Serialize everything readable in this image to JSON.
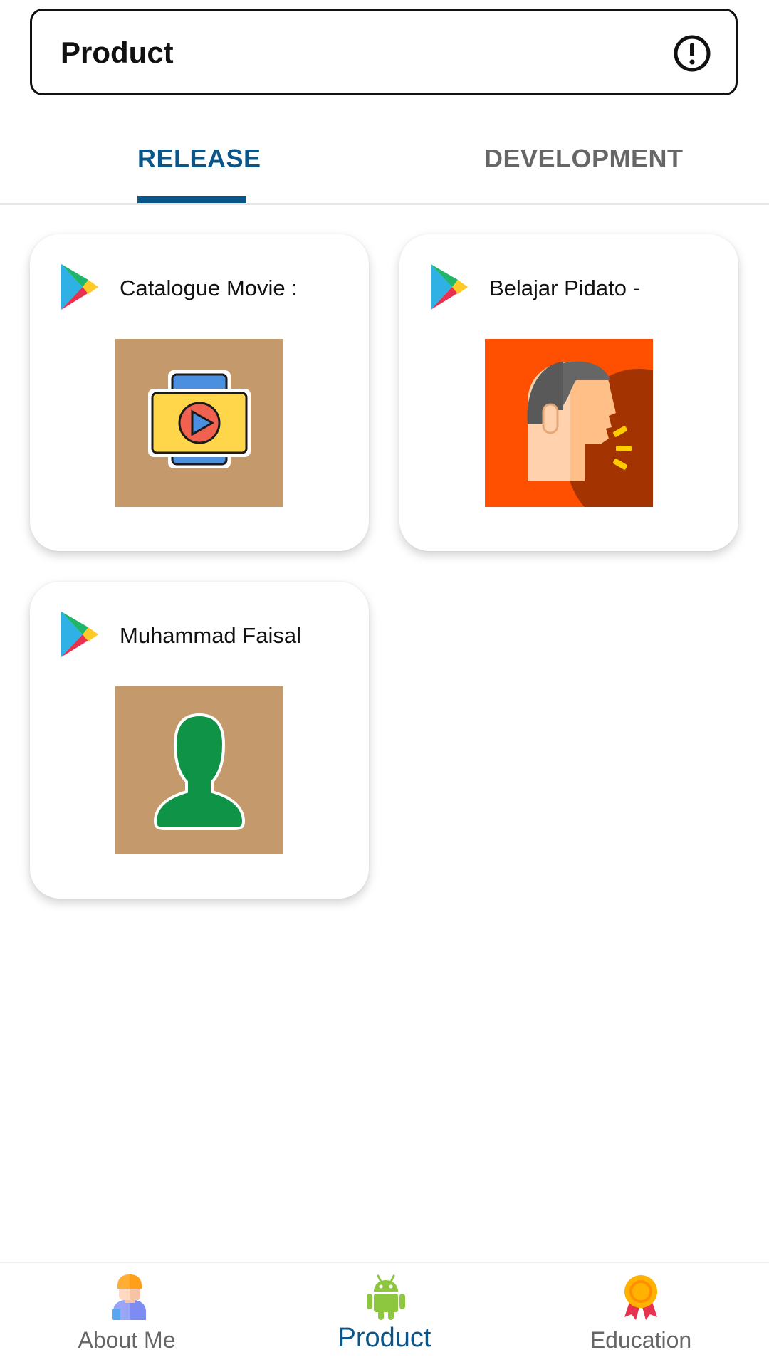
{
  "app_bar": {
    "title": "Product",
    "info_icon": "info-alert-icon"
  },
  "tabs": [
    {
      "label": "RELEASE",
      "selected": true
    },
    {
      "label": "DEVELOPMENT",
      "selected": false
    }
  ],
  "cards": [
    {
      "title": "Catalogue Movie :",
      "store_icon": "google-play-icon",
      "thumbnail_icon": "movie-player-icon",
      "thumbnail_bg": "#c4996b"
    },
    {
      "title": "Belajar Pidato -",
      "store_icon": "google-play-icon",
      "thumbnail_icon": "speaking-person-icon",
      "thumbnail_bg": "#fe5000"
    },
    {
      "title": "Muhammad Faisal",
      "store_icon": "google-play-icon",
      "thumbnail_icon": "user-silhouette-icon",
      "thumbnail_bg": "#c4996b"
    }
  ],
  "bottom_nav": [
    {
      "label": "About Me",
      "icon": "person-icon",
      "selected": false
    },
    {
      "label": "Product",
      "icon": "android-icon",
      "selected": true
    },
    {
      "label": "Education",
      "icon": "medal-icon",
      "selected": false
    }
  ],
  "colors": {
    "accent": "#0b5689",
    "inactive_text": "#666666",
    "divider": "#e6e6e6"
  }
}
